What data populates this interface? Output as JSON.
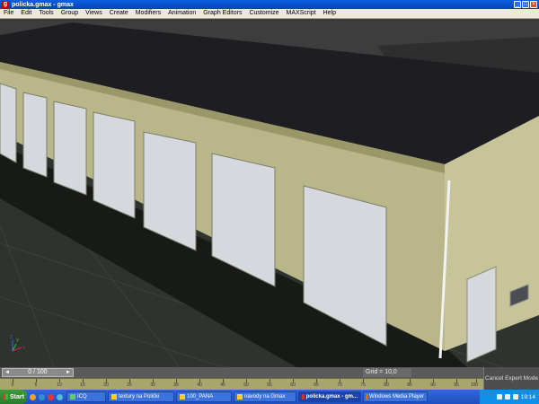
{
  "window": {
    "title": "policka.gmax - gmax",
    "app_icon_glyph": "g",
    "controls": {
      "minimize": "_",
      "maximize": "□",
      "close": "×"
    }
  },
  "menubar": {
    "items": [
      "File",
      "Edit",
      "Tools",
      "Group",
      "Views",
      "Create",
      "Modifiers",
      "Animation",
      "Graph Editors",
      "Customize",
      "MAXScript",
      "Help"
    ]
  },
  "viewport": {
    "axis_label_x": "X",
    "axis_label_y": "Y",
    "axis_label_z": "Z"
  },
  "timeline": {
    "slider_label": "0 / 100",
    "grid_readout": "Grid = 10,0",
    "expert_button": "Cancel Expert Mode"
  },
  "ruler": {
    "ticks": [
      "0",
      "5",
      "10",
      "15",
      "20",
      "25",
      "30",
      "35",
      "40",
      "45",
      "50",
      "55",
      "60",
      "65",
      "70",
      "75",
      "80",
      "85",
      "90",
      "95",
      "100"
    ]
  },
  "taskbar": {
    "start_label": "Start",
    "tasks": [
      {
        "label": "ICQ",
        "active": false
      },
      {
        "label": "textury na Polički",
        "active": false
      },
      {
        "label": "100_PANA",
        "active": false
      },
      {
        "label": "navody na Gmax",
        "active": false
      },
      {
        "label": "policka.gmax - gm...",
        "active": true
      },
      {
        "label": "Windows Media Player",
        "active": false
      }
    ],
    "clock": "19:14",
    "colors": {
      "accent": "#1f4fc0",
      "start": "#2b7d2b",
      "tray": "#0f8fe6"
    }
  }
}
